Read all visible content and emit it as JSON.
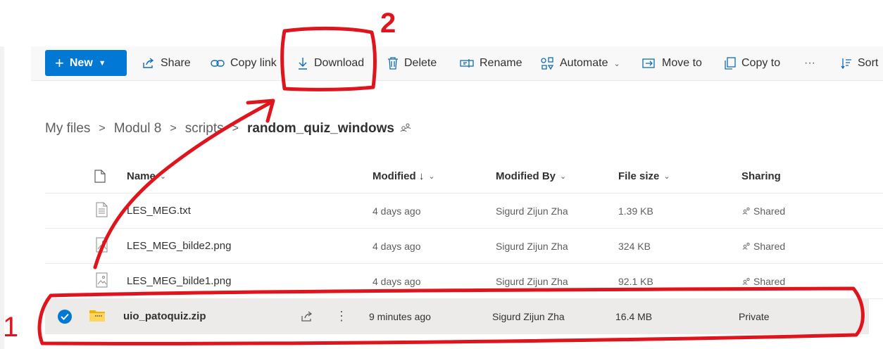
{
  "toolbar": {
    "new_label": "New",
    "share_label": "Share",
    "copy_link_label": "Copy link",
    "download_label": "Download",
    "delete_label": "Delete",
    "rename_label": "Rename",
    "automate_label": "Automate",
    "move_to_label": "Move to",
    "copy_to_label": "Copy to",
    "more_label": "···",
    "sort_label": "Sort"
  },
  "breadcrumb": [
    "My files",
    "Modul 8",
    "scripts",
    "random_quiz_windows"
  ],
  "breadcrumb_separator": ">",
  "columns": {
    "name": "Name",
    "modified": "Modified ↓",
    "modified_by": "Modified By",
    "file_size": "File size",
    "sharing": "Sharing"
  },
  "files": [
    {
      "name": "LES_MEG.txt",
      "modified": "4 days ago",
      "modified_by": "Sigurd Zijun Zha",
      "size": "1.39 KB",
      "sharing": "Shared",
      "icon": "text-file-icon"
    },
    {
      "name": "LES_MEG_bilde2.png",
      "modified": "4 days ago",
      "modified_by": "Sigurd Zijun Zha",
      "size": "324 KB",
      "sharing": "Shared",
      "icon": "image-file-icon"
    },
    {
      "name": "LES_MEG_bilde1.png",
      "modified": "4 days ago",
      "modified_by": "Sigurd Zijun Zha",
      "size": "92.1 KB",
      "sharing": "Shared",
      "icon": "image-file-icon"
    },
    {
      "name": "uio_patoquiz.zip",
      "modified": "9 minutes ago",
      "modified_by": "Sigurd Zijun Zha",
      "size": "16.4 MB",
      "sharing": "Private",
      "icon": "zip-folder-icon",
      "selected": true
    }
  ],
  "annotations": {
    "label_1": "1",
    "label_2": "2"
  },
  "colors": {
    "accent": "#0078d4",
    "annotation_red": "#e0141c",
    "selected_row": "#edebe9"
  }
}
